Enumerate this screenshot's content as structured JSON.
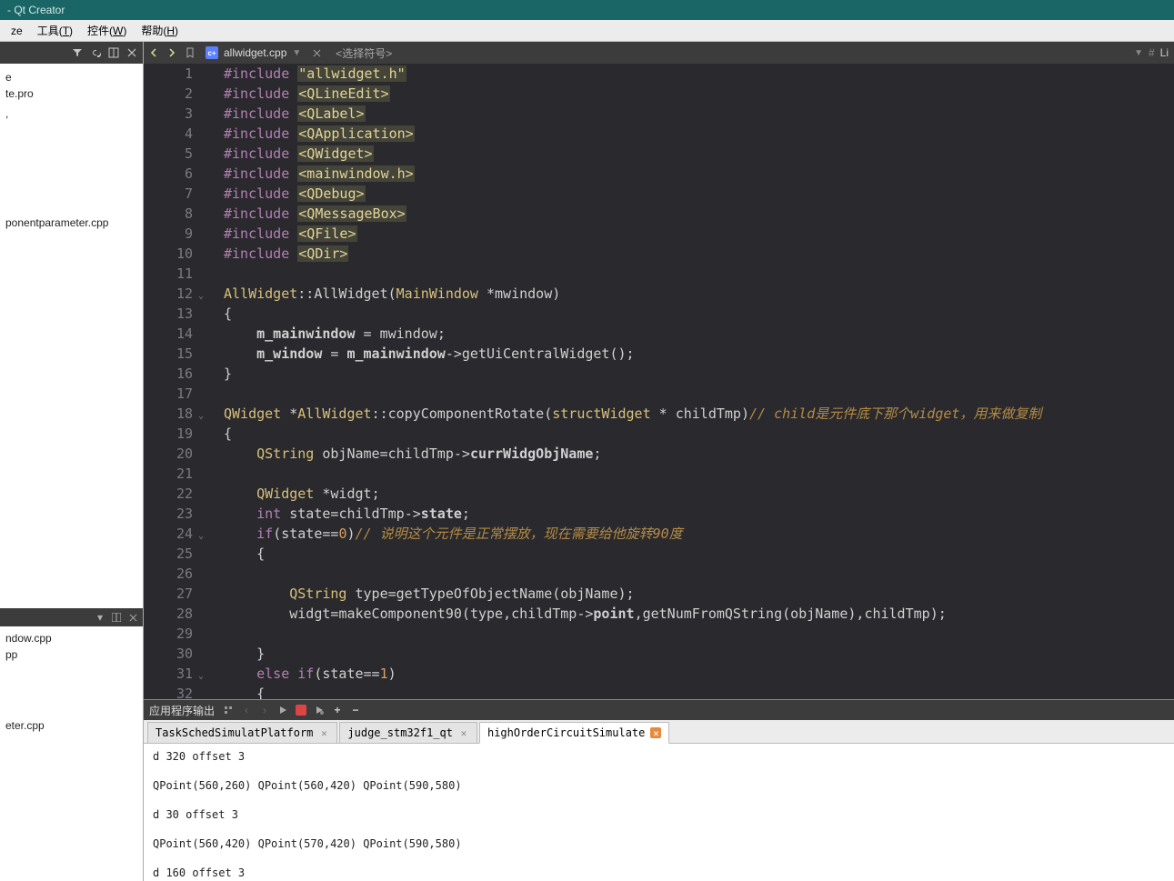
{
  "titlebar": {
    "title": "- Qt Creator"
  },
  "menubar": {
    "items": [
      {
        "label": "ze"
      },
      {
        "label": "工具(T)",
        "key": "T"
      },
      {
        "label": "控件(W)",
        "key": "W"
      },
      {
        "label": "帮助(H)",
        "key": "H"
      }
    ]
  },
  "projectTree": {
    "items": [
      {
        "label": "e"
      },
      {
        "label": "te.pro"
      },
      {
        "label": ""
      },
      {
        "label": ",",
        "spacer": true,
        "h": 120
      },
      {
        "label": "ponentparameter.cpp"
      }
    ]
  },
  "openDocs": {
    "items": [
      {
        "label": "ndow.cpp"
      },
      {
        "label": "pp"
      },
      {
        "label": "",
        "spacer": true,
        "h": 60
      },
      {
        "label": "eter.cpp"
      }
    ]
  },
  "editorTab": {
    "fileName": "allwidget.cpp",
    "symbolPlaceholder": "<选择符号>",
    "rightLabel": "Li"
  },
  "code": {
    "lines": [
      {
        "n": 1,
        "tokens": [
          [
            "kw",
            "#include"
          ],
          [
            "punct",
            " "
          ],
          [
            "inc-hl",
            "\"allwidget.h\""
          ]
        ]
      },
      {
        "n": 2,
        "tokens": [
          [
            "kw",
            "#include"
          ],
          [
            "punct",
            " "
          ],
          [
            "inc-hl",
            "<QLineEdit>"
          ]
        ]
      },
      {
        "n": 3,
        "tokens": [
          [
            "kw",
            "#include"
          ],
          [
            "punct",
            " "
          ],
          [
            "inc-hl",
            "<QLabel>"
          ]
        ]
      },
      {
        "n": 4,
        "tokens": [
          [
            "kw",
            "#include"
          ],
          [
            "punct",
            " "
          ],
          [
            "inc-hl",
            "<QApplication>"
          ]
        ]
      },
      {
        "n": 5,
        "tokens": [
          [
            "kw",
            "#include"
          ],
          [
            "punct",
            " "
          ],
          [
            "inc-hl",
            "<QWidget>"
          ]
        ]
      },
      {
        "n": 6,
        "tokens": [
          [
            "kw",
            "#include"
          ],
          [
            "punct",
            " "
          ],
          [
            "inc-hl",
            "<mainwindow.h>"
          ]
        ]
      },
      {
        "n": 7,
        "tokens": [
          [
            "kw",
            "#include"
          ],
          [
            "punct",
            " "
          ],
          [
            "inc-hl",
            "<QDebug>"
          ]
        ]
      },
      {
        "n": 8,
        "tokens": [
          [
            "kw",
            "#include"
          ],
          [
            "punct",
            " "
          ],
          [
            "inc-hl",
            "<QMessageBox>"
          ]
        ]
      },
      {
        "n": 9,
        "tokens": [
          [
            "kw",
            "#include"
          ],
          [
            "punct",
            " "
          ],
          [
            "inc-hl",
            "<QFile>"
          ]
        ]
      },
      {
        "n": 10,
        "tokens": [
          [
            "kw",
            "#include"
          ],
          [
            "punct",
            " "
          ],
          [
            "inc-hl",
            "<QDir>"
          ]
        ]
      },
      {
        "n": 11,
        "tokens": []
      },
      {
        "n": 12,
        "fold": true,
        "tokens": [
          [
            "typename",
            "AllWidget"
          ],
          [
            "punct",
            "::"
          ],
          [
            "ident",
            "AllWidget"
          ],
          [
            "punct",
            "("
          ],
          [
            "typename",
            "MainWindow"
          ],
          [
            "punct",
            " *"
          ],
          [
            "ident",
            "mwindow"
          ],
          [
            "punct",
            ")"
          ]
        ]
      },
      {
        "n": 13,
        "tokens": [
          [
            "punct",
            "{"
          ]
        ]
      },
      {
        "n": 14,
        "tokens": [
          [
            "punct",
            "    "
          ],
          [
            "member",
            "m_mainwindow"
          ],
          [
            "punct",
            " = "
          ],
          [
            "ident",
            "mwindow"
          ],
          [
            "punct",
            ";"
          ]
        ]
      },
      {
        "n": 15,
        "tokens": [
          [
            "punct",
            "    "
          ],
          [
            "member",
            "m_window"
          ],
          [
            "punct",
            " = "
          ],
          [
            "member",
            "m_mainwindow"
          ],
          [
            "punct",
            "->"
          ],
          [
            "ident",
            "getUiCentralWidget"
          ],
          [
            "punct",
            "();"
          ]
        ]
      },
      {
        "n": 16,
        "tokens": [
          [
            "punct",
            "}"
          ]
        ]
      },
      {
        "n": 17,
        "tokens": []
      },
      {
        "n": 18,
        "fold": true,
        "tokens": [
          [
            "typename",
            "QWidget"
          ],
          [
            "punct",
            " *"
          ],
          [
            "typename",
            "AllWidget"
          ],
          [
            "punct",
            "::"
          ],
          [
            "ident",
            "copyComponentRotate"
          ],
          [
            "punct",
            "("
          ],
          [
            "typename",
            "structWidget"
          ],
          [
            "punct",
            " * "
          ],
          [
            "ident",
            "childTmp"
          ],
          [
            "punct",
            ")"
          ],
          [
            "comment",
            "// child是元件底下那个widget，用来做复制"
          ]
        ]
      },
      {
        "n": 19,
        "tokens": [
          [
            "punct",
            "{"
          ]
        ]
      },
      {
        "n": 20,
        "tokens": [
          [
            "punct",
            "    "
          ],
          [
            "typename",
            "QString"
          ],
          [
            "punct",
            " "
          ],
          [
            "ident",
            "objName"
          ],
          [
            "punct",
            "="
          ],
          [
            "ident",
            "childTmp"
          ],
          [
            "punct",
            "->"
          ],
          [
            "member",
            "currWidgObjName"
          ],
          [
            "punct",
            ";"
          ]
        ]
      },
      {
        "n": 21,
        "tokens": []
      },
      {
        "n": 22,
        "tokens": [
          [
            "punct",
            "    "
          ],
          [
            "typename",
            "QWidget"
          ],
          [
            "punct",
            " *"
          ],
          [
            "ident",
            "widgt"
          ],
          [
            "punct",
            ";"
          ]
        ]
      },
      {
        "n": 23,
        "tokens": [
          [
            "punct",
            "    "
          ],
          [
            "type",
            "int"
          ],
          [
            "punct",
            " "
          ],
          [
            "ident",
            "state"
          ],
          [
            "punct",
            "="
          ],
          [
            "ident",
            "childTmp"
          ],
          [
            "punct",
            "->"
          ],
          [
            "member",
            "state"
          ],
          [
            "punct",
            ";"
          ]
        ]
      },
      {
        "n": 24,
        "fold": true,
        "tokens": [
          [
            "punct",
            "    "
          ],
          [
            "kw",
            "if"
          ],
          [
            "punct",
            "("
          ],
          [
            "ident",
            "state"
          ],
          [
            "punct",
            "=="
          ],
          [
            "num",
            "0"
          ],
          [
            "punct",
            ")"
          ],
          [
            "comment",
            "// 说明这个元件是正常摆放，现在需要给他旋转90度"
          ]
        ]
      },
      {
        "n": 25,
        "tokens": [
          [
            "punct",
            "    {"
          ]
        ]
      },
      {
        "n": 26,
        "tokens": []
      },
      {
        "n": 27,
        "tokens": [
          [
            "punct",
            "        "
          ],
          [
            "typename",
            "QString"
          ],
          [
            "punct",
            " "
          ],
          [
            "ident",
            "type"
          ],
          [
            "punct",
            "="
          ],
          [
            "ident",
            "getTypeOfObjectName"
          ],
          [
            "punct",
            "("
          ],
          [
            "ident",
            "objName"
          ],
          [
            "punct",
            ");"
          ]
        ]
      },
      {
        "n": 28,
        "tokens": [
          [
            "punct",
            "        "
          ],
          [
            "ident",
            "widgt"
          ],
          [
            "punct",
            "="
          ],
          [
            "ident",
            "makeComponent90"
          ],
          [
            "punct",
            "("
          ],
          [
            "ident",
            "type"
          ],
          [
            "punct",
            ","
          ],
          [
            "ident",
            "childTmp"
          ],
          [
            "punct",
            "->"
          ],
          [
            "member",
            "point"
          ],
          [
            "punct",
            ","
          ],
          [
            "ident",
            "getNumFromQString"
          ],
          [
            "punct",
            "("
          ],
          [
            "ident",
            "objName"
          ],
          [
            "punct",
            ")"
          ],
          [
            "punct",
            ","
          ],
          [
            "ident",
            "childTmp"
          ],
          [
            "punct",
            ");"
          ]
        ]
      },
      {
        "n": 29,
        "tokens": []
      },
      {
        "n": 30,
        "tokens": [
          [
            "punct",
            "    }"
          ]
        ]
      },
      {
        "n": 31,
        "fold": true,
        "tokens": [
          [
            "punct",
            "    "
          ],
          [
            "kw",
            "else"
          ],
          [
            "punct",
            " "
          ],
          [
            "kw",
            "if"
          ],
          [
            "punct",
            "("
          ],
          [
            "ident",
            "state"
          ],
          [
            "punct",
            "=="
          ],
          [
            "num",
            "1"
          ],
          [
            "punct",
            ")"
          ]
        ]
      },
      {
        "n": 32,
        "tokens": [
          [
            "punct",
            "    {"
          ]
        ]
      }
    ]
  },
  "output": {
    "headerTitle": "应用程序输出",
    "tabs": [
      {
        "label": "TaskSchedSimulatPlatform",
        "closeStyle": "gray"
      },
      {
        "label": "judge_stm32f1_qt",
        "closeStyle": "gray"
      },
      {
        "label": "highOrderCircuitSimulate",
        "closeStyle": "orange",
        "active": true
      }
    ],
    "lines": [
      "d 320 offset 3",
      "",
      "QPoint(560,260) QPoint(560,420) QPoint(590,580)",
      "",
      "d 30 offset 3",
      "",
      "QPoint(560,420) QPoint(570,420) QPoint(590,580)",
      "",
      "d 160 offset 3"
    ]
  }
}
